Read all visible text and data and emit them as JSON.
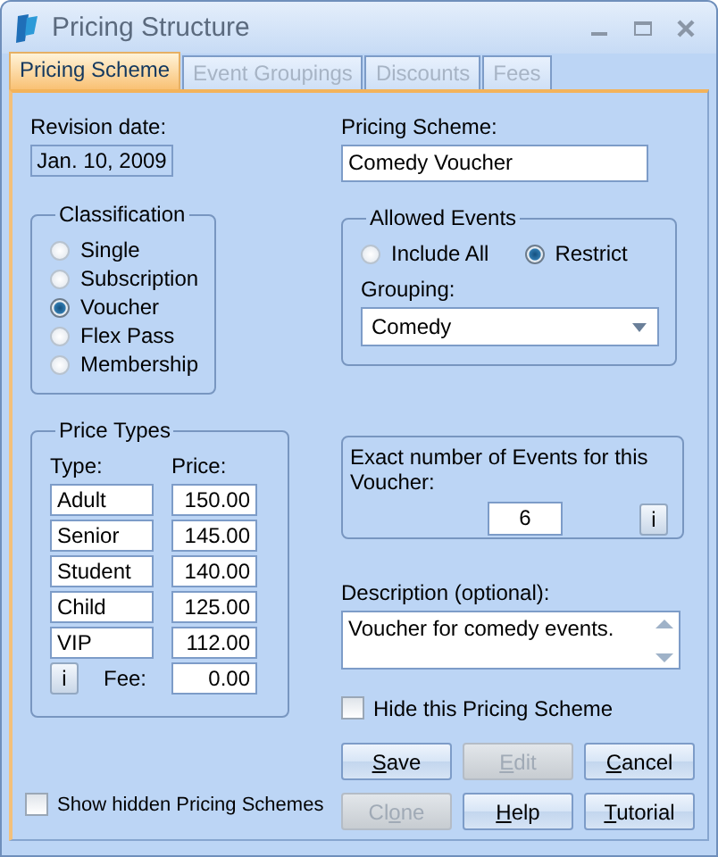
{
  "window": {
    "title": "Pricing Structure"
  },
  "tabs": [
    {
      "label": "Pricing Scheme",
      "selected": true,
      "disabled": false
    },
    {
      "label": "Event Groupings",
      "selected": false,
      "disabled": true
    },
    {
      "label": "Discounts",
      "selected": false,
      "disabled": true
    },
    {
      "label": "Fees",
      "selected": false,
      "disabled": true
    }
  ],
  "revision_date": {
    "label": "Revision date:",
    "value": "Jan. 10, 2009"
  },
  "pricing_scheme": {
    "label": "Pricing Scheme:",
    "value": "Comedy Voucher"
  },
  "classification": {
    "title": "Classification",
    "options": [
      {
        "label": "Single",
        "selected": false
      },
      {
        "label": "Subscription",
        "selected": false
      },
      {
        "label": "Voucher",
        "selected": true
      },
      {
        "label": "Flex Pass",
        "selected": false
      },
      {
        "label": "Membership",
        "selected": false
      }
    ]
  },
  "allowed_events": {
    "title": "Allowed Events",
    "options": [
      {
        "label": "Include All",
        "selected": false
      },
      {
        "label": "Restrict",
        "selected": true
      }
    ],
    "grouping_label": "Grouping:",
    "grouping_value": "Comedy"
  },
  "price_types": {
    "title": "Price Types",
    "type_header": "Type:",
    "price_header": "Price:",
    "rows": [
      {
        "type": "Adult",
        "price": "150.00"
      },
      {
        "type": "Senior",
        "price": "145.00"
      },
      {
        "type": "Student",
        "price": "140.00"
      },
      {
        "type": "Child",
        "price": "125.00"
      },
      {
        "type": "VIP",
        "price": "112.00"
      }
    ],
    "info_button": "i",
    "fee_label": "Fee:",
    "fee_value": "0.00"
  },
  "exact_events": {
    "label": "Exact number of Events for this Voucher:",
    "value": "6",
    "info_button": "i"
  },
  "description": {
    "label": "Description (optional):",
    "value": "Voucher for comedy events."
  },
  "hide_scheme": {
    "label": "Hide this Pricing Scheme",
    "checked": false
  },
  "buttons": [
    {
      "label_parts": [
        {
          "text": "S",
          "underlined": true
        },
        {
          "text": "ave",
          "underlined": false
        }
      ],
      "disabled": false
    },
    {
      "label_parts": [
        {
          "text": "E",
          "underlined": true
        },
        {
          "text": "dit",
          "underlined": false
        }
      ],
      "disabled": true
    },
    {
      "label_parts": [
        {
          "text": "C",
          "underlined": true
        },
        {
          "text": "ancel",
          "underlined": false
        }
      ],
      "disabled": false
    },
    {
      "label_parts": [
        {
          "text": "Cl",
          "underlined": false
        },
        {
          "text": "o",
          "underlined": true
        },
        {
          "text": "ne",
          "underlined": false
        }
      ],
      "disabled": true
    },
    {
      "label_parts": [
        {
          "text": "H",
          "underlined": true
        },
        {
          "text": "elp",
          "underlined": false
        }
      ],
      "disabled": false
    },
    {
      "label_parts": [
        {
          "text": "T",
          "underlined": true
        },
        {
          "text": "utorial",
          "underlined": false
        }
      ],
      "disabled": false
    }
  ],
  "show_hidden": {
    "label": "Show hidden Pricing Schemes",
    "checked": false
  }
}
